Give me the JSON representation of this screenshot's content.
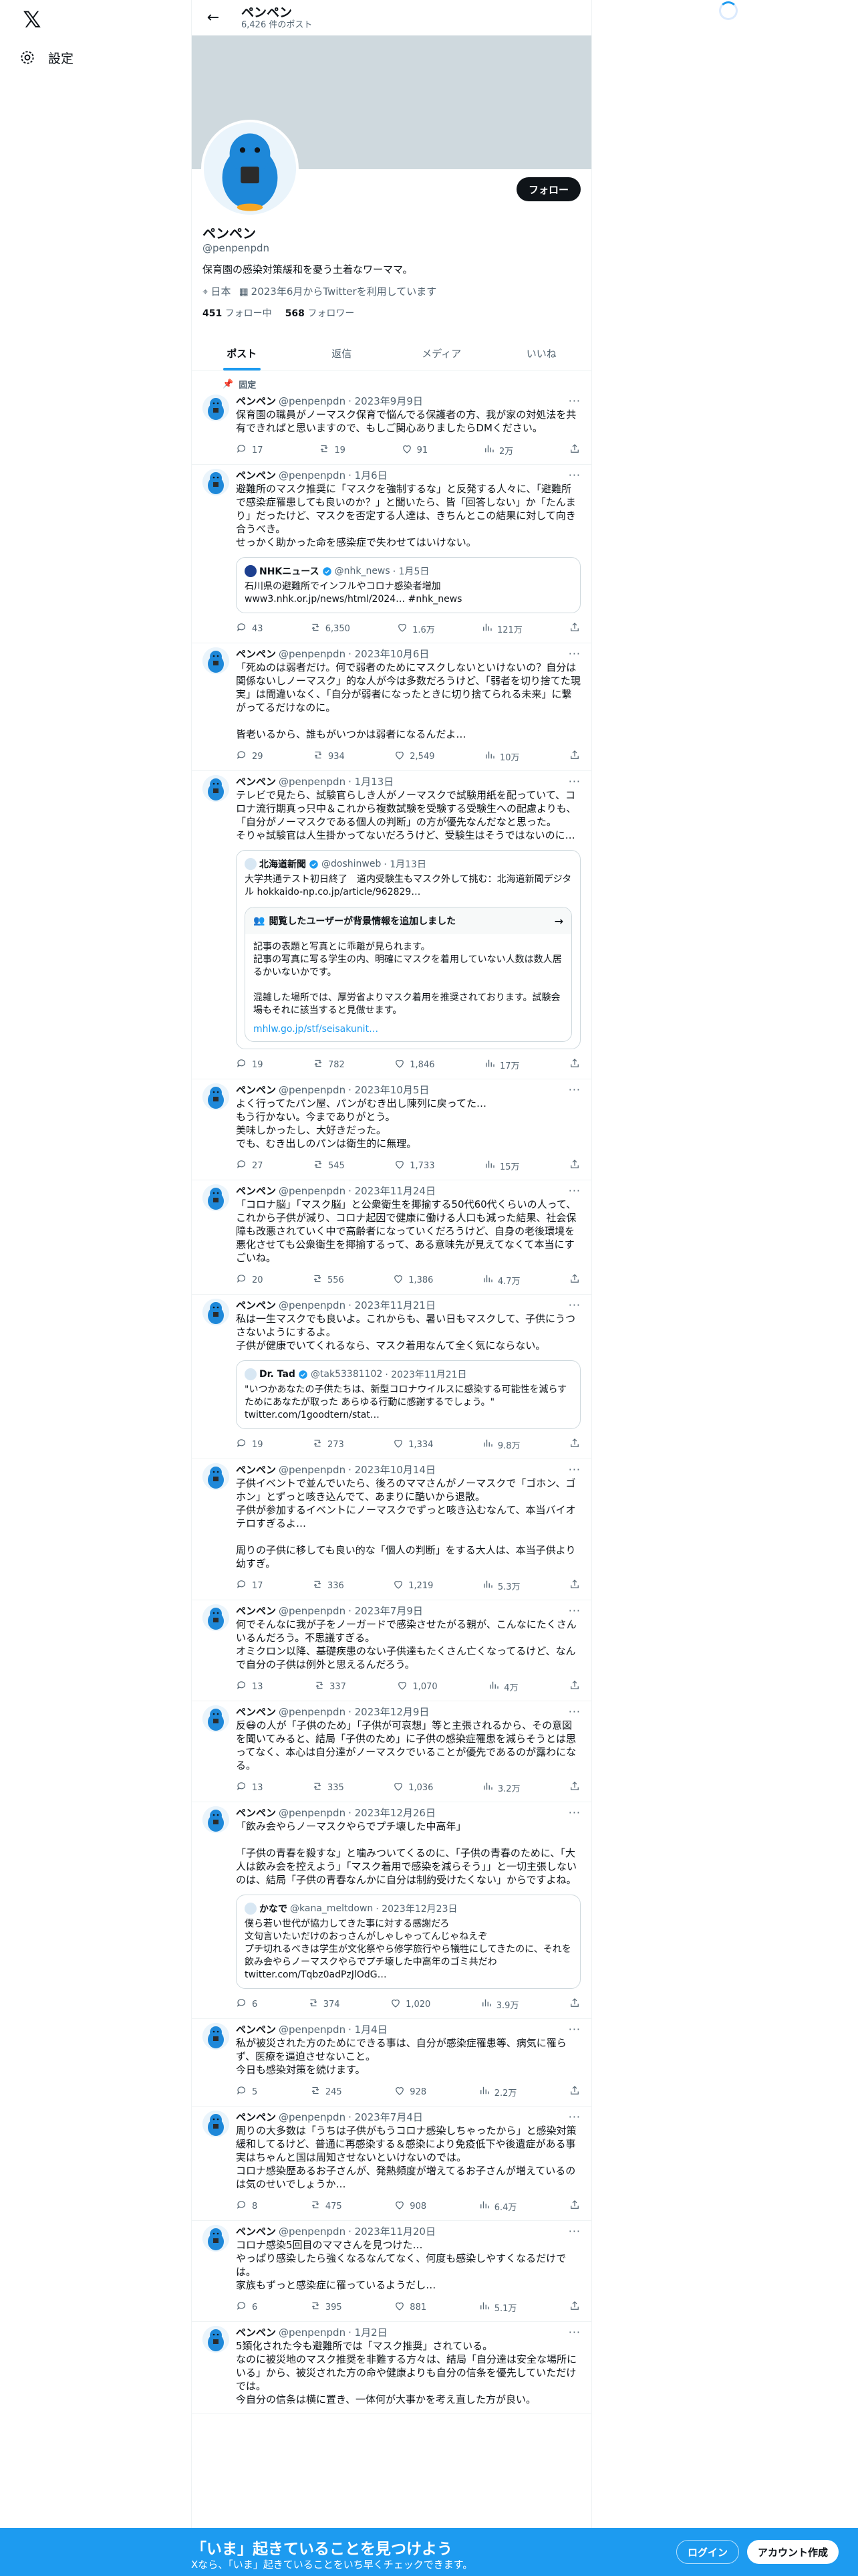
{
  "nav": {
    "logo": "𝕏",
    "settings_label": "設定"
  },
  "profile": {
    "header_name": "ペンペン",
    "post_count": "6,426 件のポスト",
    "name": "ペンペン",
    "handle": "@penpenpdn",
    "bio": "保育園の感染対策緩和を憂う土着なワーママ。",
    "location": "日本",
    "joined": "2023年6月からTwitterを利用しています",
    "following_count": "451",
    "following_label": "フォロー中",
    "followers_count": "568",
    "followers_label": "フォロワー",
    "follow_button": "フォロー"
  },
  "tabs": [
    {
      "label": "ポスト"
    },
    {
      "label": "返信"
    },
    {
      "label": "メディア"
    },
    {
      "label": "いいね"
    }
  ],
  "pinned_label": "固定",
  "tweets": [
    {
      "name": "ペンペン",
      "handle": "@penpenpdn",
      "date": "· 2023年9月9日",
      "text": "保育園の職員がノーマスク保育で悩んでる保護者の方、我が家の対処法を共有できればと思いますので、もしご関心ありましたらDMください。",
      "replies": "17",
      "reposts": "19",
      "likes": "91",
      "views": "2万"
    },
    {
      "name": "ペンペン",
      "handle": "@penpenpdn",
      "date": "· 1月6日",
      "text": "避難所のマスク推奨に「マスクを強制するな」と反発する人々に、「避難所で感染症罹患しても良いのか？」と聞いたら、皆「回答しない」か「たんまり」だったけど、マスクを否定する人達は、きちんとこの結果に対して向き合うべき。\nせっかく助かった命を感染症で失わせてはいけない。",
      "quote": {
        "name": "NHKニュース",
        "handle": "@nhk_news",
        "date": "· 1月5日",
        "text": "石川県の避難所でインフルやコロナ感染者増加\nwww3.nhk.or.jp/news/html/2024… #nhk_news"
      },
      "replies": "43",
      "reposts": "6,350",
      "likes": "1.6万",
      "views": "121万"
    },
    {
      "name": "ペンペン",
      "handle": "@penpenpdn",
      "date": "· 2023年10月6日",
      "text": "「死ぬのは弱者だけ。何で弱者のためにマスクしないといけないの？自分は関係ないしノーマスク」的な人が今は多数だろうけど、「弱者を切り捨てた現実」は間違いなく、「自分が弱者になったときに切り捨てられる未来」に繋がってるだけなのに。\n\n皆老いるから、誰もがいつかは弱者になるんだよ…",
      "replies": "29",
      "reposts": "934",
      "likes": "2,549",
      "views": "10万"
    },
    {
      "name": "ペンペン",
      "handle": "@penpenpdn",
      "date": "· 1月13日",
      "text": "テレビで見たら、試験官らしき人がノーマスクで試験用紙を配っていて、コロナ流行期真っ只中＆これから複数試験を受験する受験生への配慮よりも、「自分がノーマスクである個人の判断」の方が優先なんだなと思った。\nそりゃ試験官は人生掛かってないだろうけど、受験生はそうではないのに…",
      "quote": {
        "name": "北海道新聞",
        "handle": "@doshinweb",
        "date": "· 1月13日",
        "text": "大学共通テスト初日終了　道内受験生もマスク外して挑む：北海道新聞デジタル hokkaido-np.co.jp/article/962829…"
      },
      "note": {
        "title": "閲覧したユーザーが背景情報を追加しました",
        "text": "記事の表題と写真とに乖離が見られます。\n記事の写真に写る学生の内、明確にマスクを着用していない人数は数人居るかいないかです。\n\n混雑した場所では、厚労省よりマスク着用を推奨されております。試験会場もそれに該当すると見做せます。",
        "link": "mhlw.go.jp/stf/seisakunit…"
      },
      "replies": "19",
      "reposts": "782",
      "likes": "1,846",
      "views": "17万"
    },
    {
      "name": "ペンペン",
      "handle": "@penpenpdn",
      "date": "· 2023年10月5日",
      "text": "よく行ってたパン屋、パンがむき出し陳列に戻ってた…\nもう行かない。今までありがとう。\n美味しかったし、大好きだった。\nでも、むき出しのパンは衛生的に無理。",
      "replies": "27",
      "reposts": "545",
      "likes": "1,733",
      "views": "15万"
    },
    {
      "name": "ペンペン",
      "handle": "@penpenpdn",
      "date": "· 2023年11月24日",
      "text": "「コロナ脳」「マスク脳」と公衆衛生を揶揄する50代60代くらいの人って、これから子供が減り、コロナ起因で健康に働ける人口も減った結果、社会保障も改悪されていく中で高齢者になっていくだろうけど、自身の老後環境を悪化させても公衆衛生を揶揄するって、ある意味先が見えてなくて本当にすごいね。",
      "replies": "20",
      "reposts": "556",
      "likes": "1,386",
      "views": "4.7万"
    },
    {
      "name": "ペンペン",
      "handle": "@penpenpdn",
      "date": "· 2023年11月21日",
      "text": "私は一生マスクでも良いよ。これからも、暑い日もマスクして、子供にうつさないようにするよ。\n子供が健康でいてくれるなら、マスク着用なんて全く気にならない。",
      "quote": {
        "name": "Dr. Tad",
        "handle": "@tak53381102",
        "date": "· 2023年11月21日",
        "text": "\"いつかあなたの子供たちは、新型コロナウイルスに感染する可能性を減らすためにあなたが取った あらゆる行動に感謝するでしょう。\"\ntwitter.com/1goodtern/stat…"
      },
      "replies": "19",
      "reposts": "273",
      "likes": "1,334",
      "views": "9.8万"
    },
    {
      "name": "ペンペン",
      "handle": "@penpenpdn",
      "date": "· 2023年10月14日",
      "text": "子供イベントで並んでいたら、後ろのママさんがノーマスクで「ゴホン、ゴホン」とずっと咳き込んでて、あまりに酷いから退散。\n子供が参加するイベントにノーマスクでずっと咳き込むなんて、本当バイオテロすぎるよ…\n\n周りの子供に移しても良い的な「個人の判断」をする大人は、本当子供より幼すぎ。",
      "replies": "17",
      "reposts": "336",
      "likes": "1,219",
      "views": "5.3万"
    },
    {
      "name": "ペンペン",
      "handle": "@penpenpdn",
      "date": "· 2023年7月9日",
      "text": "何でそんなに我が子をノーガードで感染させたがる親が、こんなにたくさんいるんだろう。不思議すぎる。\nオミクロン以降、基礎疾患のない子供達もたくさん亡くなってるけど、なんで自分の子供は例外と思えるんだろう。",
      "replies": "13",
      "reposts": "337",
      "likes": "1,070",
      "views": "4万"
    },
    {
      "name": "ペンペン",
      "handle": "@penpenpdn",
      "date": "· 2023年12月9日",
      "text": "反😷の人が「子供のため」「子供が可哀想」等と主張されるから、その意図を聞いてみると、結局「子供のため」に子供の感染症罹患を減らそうとは思ってなく、本心は自分達がノーマスクでいることが優先であるのが露わになる。",
      "replies": "13",
      "reposts": "335",
      "likes": "1,036",
      "views": "3.2万"
    },
    {
      "name": "ペンペン",
      "handle": "@penpenpdn",
      "date": "· 2023年12月26日",
      "text": "「飲み会やらノーマスクやらでプチ壊した中高年」\n\n「子供の青春を殺すな」と噛みついてくるのに、「子供の青春のために、「大人は飲み会を控えよう」「マスク着用で感染を減らそう」」と一切主張しないのは、結局「子供の青春なんかに自分は制約受けたくない」からですよね。",
      "quote": {
        "name": "かなで",
        "handle": "@kana_meltdown",
        "date": "· 2023年12月23日",
        "text": "僕ら若い世代が協力してきた事に対する感謝だろ\n文句言いたいだけのおっさんがしゃしゃってんじゃねえぞ\nプチ切れるべきは学生が文化祭やら修学旅行やら犠牲にしてきたのに、それを飲み会やらノーマスクやらでプチ壊した中高年のゴミ共だわ\ntwitter.com/Tqbz0adPzJlOdG…"
      },
      "replies": "6",
      "reposts": "374",
      "likes": "1,020",
      "views": "3.9万"
    },
    {
      "name": "ペンペン",
      "handle": "@penpenpdn",
      "date": "· 1月4日",
      "text": "私が被災された方のためにできる事は、自分が感染症罹患等、病気に罹らず、医療を逼迫させないこと。\n今日も感染対策を続けます。",
      "replies": "5",
      "reposts": "245",
      "likes": "928",
      "views": "2.2万"
    },
    {
      "name": "ペンペン",
      "handle": "@penpenpdn",
      "date": "· 2023年7月4日",
      "text": "周りの大多数は「うちは子供がもうコロナ感染しちゃったから」と感染対策緩和してるけど、普通に再感染する＆感染により免疫低下や後遺症がある事実はちゃんと国は周知させないといけないのでは。\nコロナ感染歴あるお子さんが、発熱頻度が増えてるお子さんが増えているのは気のせいでしょうか…",
      "replies": "8",
      "reposts": "475",
      "likes": "908",
      "views": "6.4万"
    },
    {
      "name": "ペンペン",
      "handle": "@penpenpdn",
      "date": "· 2023年11月20日",
      "text": "コロナ感染5回目のママさんを見つけた…\nやっぱり感染したら強くなるなんてなく、何度も感染しやすくなるだけでは。\n家族もずっと感染症に罹っているようだし…",
      "replies": "6",
      "reposts": "395",
      "likes": "881",
      "views": "5.1万"
    },
    {
      "name": "ペンペン",
      "handle": "@penpenpdn",
      "date": "· 1月2日",
      "text": "5類化された今も避難所では「マスク推奨」されている。\nなのに被災地のマスク推奨を非難する方々は、結局「自分達は安全な場所にいる」から、被災された方の命や健康よりも自分の信条を優先していただけでは。\n今自分の信条は横に置き、一体何が大事かを考え直した方が良い。",
      "replies": "",
      "reposts": "",
      "likes": "",
      "views": ""
    }
  ],
  "bottom_banner": {
    "title": "「いま」起きていることを見つけよう",
    "subtitle": "Xなら、「いま」起きていることをいち早くチェックできます。",
    "login": "ログイン",
    "signup": "アカウント作成"
  },
  "colors": {
    "accent": "#1d9bf0",
    "text": "#0f1419",
    "muted": "#536471",
    "border": "#eff3f4"
  }
}
